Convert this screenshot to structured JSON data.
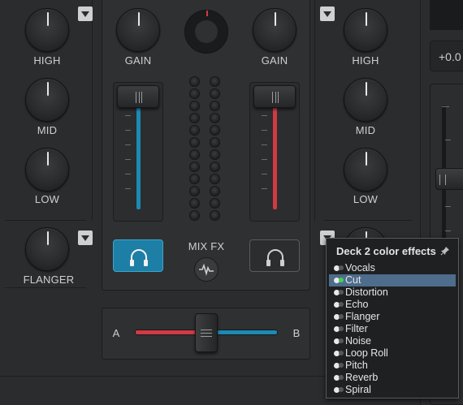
{
  "colors": {
    "deck1_accent": "#1c8ab4",
    "deck2_accent": "#d13a45",
    "selected_item": "#4e6c8c",
    "active_led": "#3fd34a"
  },
  "left_deck_eq": {
    "high_label": "HIGH",
    "mid_label": "MID",
    "low_label": "LOW",
    "fx_label": "FLANGER"
  },
  "right_deck_eq": {
    "high_label": "HIGH",
    "mid_label": "MID",
    "low_label": "LOW"
  },
  "mixer": {
    "gain_left_label": "GAIN",
    "gain_right_label": "GAIN",
    "mix_fx_label": "MIX FX",
    "crossfader_a_label": "A",
    "crossfader_b_label": "B",
    "crossfader_position": 0.5,
    "left_volume_level": 0.95,
    "right_volume_level": 0.95
  },
  "right_panel": {
    "pitch_readout": "+0.0"
  },
  "icons": {
    "headphones": "headphones-icon",
    "waveform": "waveform-icon",
    "pin": "pin-icon",
    "dropdown": "chevron-down-icon"
  },
  "effects_menu": {
    "title": "Deck 2 color effects",
    "selected": "Cut",
    "items": [
      "Vocals",
      "Cut",
      "Distortion",
      "Echo",
      "Flanger",
      "Filter",
      "Noise",
      "Loop Roll",
      "Pitch",
      "Reverb",
      "Spiral"
    ]
  }
}
